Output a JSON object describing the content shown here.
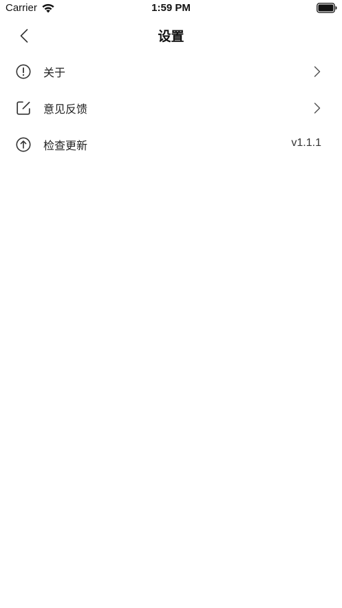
{
  "status_bar": {
    "carrier": "Carrier",
    "time": "1:59 PM"
  },
  "nav": {
    "title": "设置",
    "back_icon": "chevron-left-icon"
  },
  "settings": {
    "items": [
      {
        "label": "关于",
        "icon": "info-circle-icon",
        "trailing": "chevron"
      },
      {
        "label": "意见反馈",
        "icon": "edit-square-icon",
        "trailing": "chevron"
      },
      {
        "label": "检查更新",
        "icon": "arrow-up-circle-icon",
        "trailing": "value",
        "value": "v1.1.1"
      }
    ]
  },
  "colors": {
    "background": "#ffffff",
    "text_primary": "#222222",
    "icon": "#333333",
    "chevron": "#555555"
  }
}
